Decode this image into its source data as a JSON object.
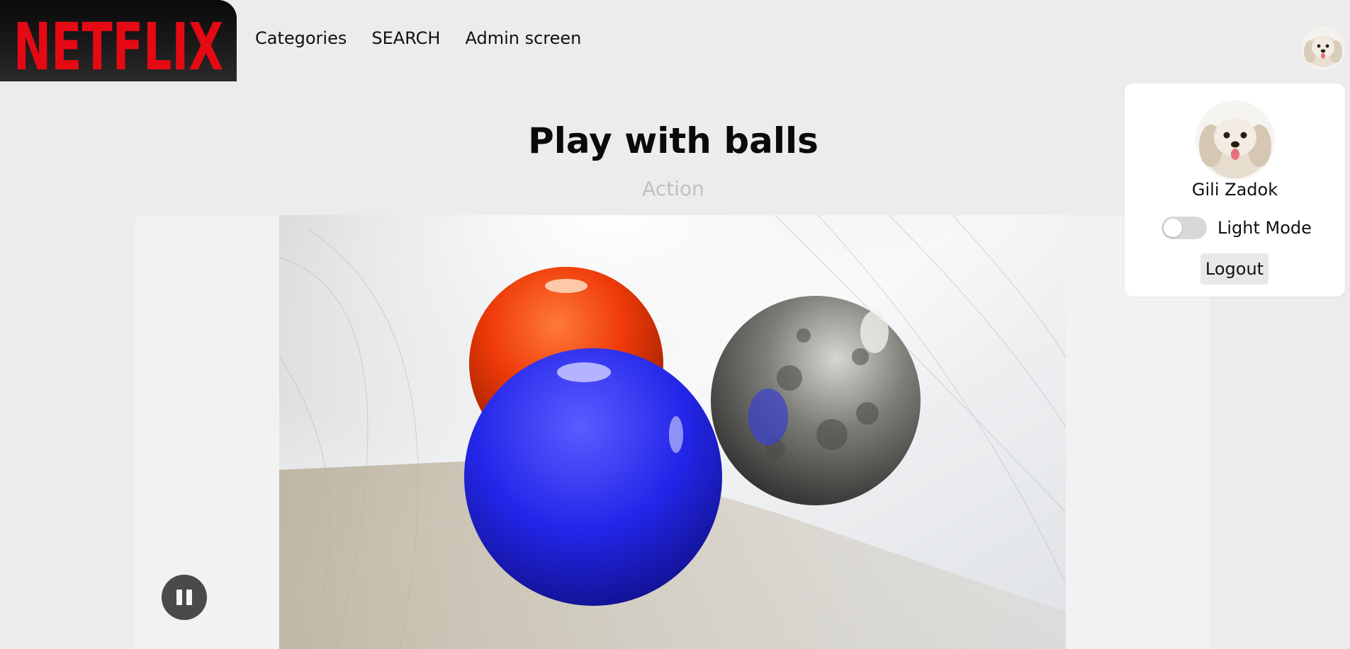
{
  "brand": {
    "logo_text": "NETFLIX",
    "logo_color": "#e50914"
  },
  "nav": {
    "links": [
      "Categories",
      "SEARCH",
      "Admin screen"
    ]
  },
  "movie": {
    "title": "Play with balls",
    "category": "Action"
  },
  "player": {
    "state": "playing",
    "control_icon": "pause-icon"
  },
  "profile_menu": {
    "user_name": "Gili Zadok",
    "theme_toggle_label": "Light Mode",
    "theme_toggle_on": false,
    "logout_label": "Logout"
  },
  "colors": {
    "background": "#ececec",
    "accent": "#e50914"
  }
}
